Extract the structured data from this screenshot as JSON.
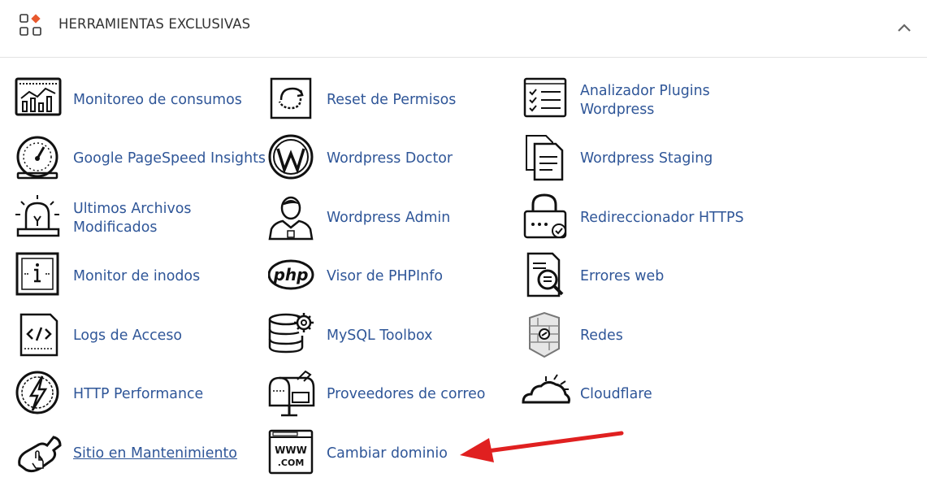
{
  "header": {
    "title": "HERRAMIENTAS EXCLUSIVAS",
    "icon": "apps-grid-icon",
    "accent": "#e8592e",
    "collapse_icon": "chevron-up-icon"
  },
  "tools": {
    "col1": [
      {
        "label": "Monitoreo de consumos",
        "icon": "usage-chart-icon"
      },
      {
        "label": "Google PageSpeed Insights",
        "icon": "speedometer-icon"
      },
      {
        "label": "Ultimos Archivos Modificados",
        "icon": "alarm-light-icon"
      },
      {
        "label": "Monitor de inodos",
        "icon": "inode-monitor-icon"
      },
      {
        "label": "Logs de Acceso",
        "icon": "code-file-icon"
      },
      {
        "label": "HTTP Performance",
        "icon": "lightning-icon"
      },
      {
        "label": "Sitio en Mantenimiento",
        "icon": "maintenance-wrench-icon"
      }
    ],
    "col2": [
      {
        "label": "Reset de Permisos",
        "icon": "reset-icon"
      },
      {
        "label": "Wordpress Doctor",
        "icon": "wordpress-icon"
      },
      {
        "label": "Wordpress Admin",
        "icon": "admin-user-icon"
      },
      {
        "label": "Visor de PHPInfo",
        "icon": "php-icon"
      },
      {
        "label": "MySQL Toolbox",
        "icon": "database-gear-icon"
      },
      {
        "label": "Proveedores de correo",
        "icon": "mailbox-icon"
      },
      {
        "label": "Cambiar dominio",
        "icon": "www-browser-icon"
      }
    ],
    "col3": [
      {
        "label": "Analizador Plugins Wordpress",
        "icon": "checklist-icon"
      },
      {
        "label": "Wordpress Staging",
        "icon": "documents-icon"
      },
      {
        "label": "Redireccionador HTTPS",
        "icon": "padlock-check-icon"
      },
      {
        "label": "Errores web",
        "icon": "file-search-icon"
      },
      {
        "label": "Redes",
        "icon": "firewall-icon"
      },
      {
        "label": "Cloudflare",
        "icon": "cloud-icon"
      }
    ]
  },
  "colors": {
    "link": "#2f5698",
    "arrow": "#e02020"
  }
}
